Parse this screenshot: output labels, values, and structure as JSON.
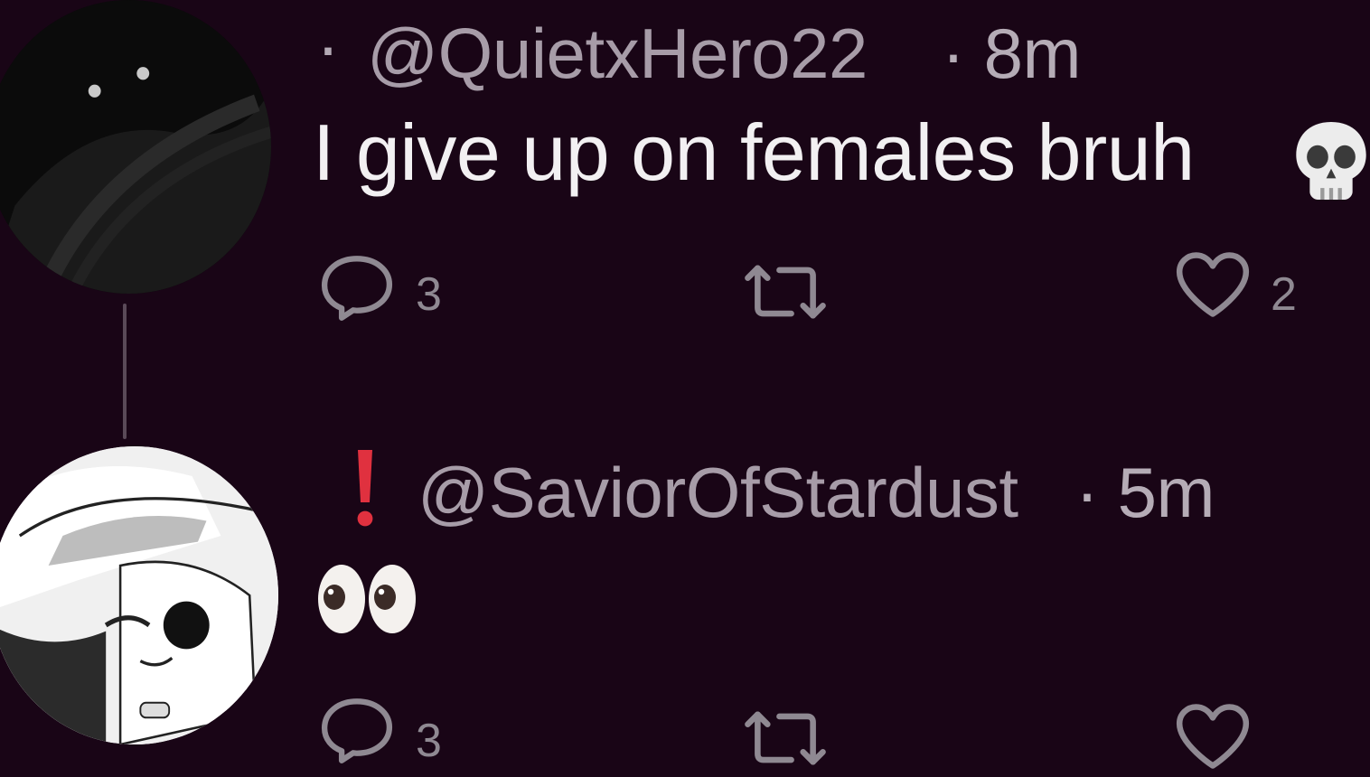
{
  "posts": [
    {
      "handle": "@QuietxHero22",
      "time": "· 8m",
      "text": "I give up on females bruh",
      "emoji": "skull-icon",
      "replies": "3",
      "likes": "2"
    },
    {
      "handle": "@SaviorOfStardust",
      "time": "· 5m",
      "emoji": "eyes-icon",
      "replies": "3"
    }
  ],
  "colors": {
    "background": "#190516",
    "handle": "#a79ca8",
    "body_text": "#f2f0f2",
    "icon": "#8f8992",
    "exclamation": "#e0313f"
  }
}
